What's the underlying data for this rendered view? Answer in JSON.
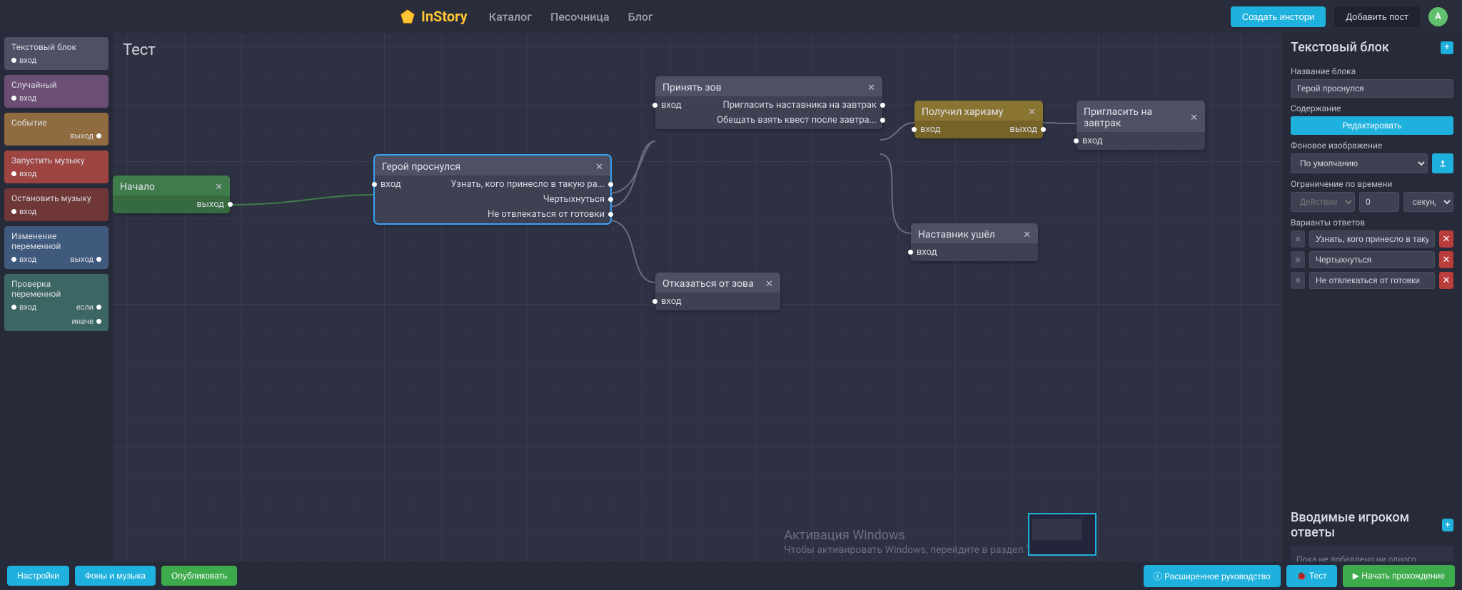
{
  "header": {
    "brand": "InStory",
    "links": [
      "Каталог",
      "Песочница",
      "Блог"
    ],
    "create_story": "Создать инстори",
    "add_post": "Добавить пост",
    "avatar_initial": "A"
  },
  "palette": [
    {
      "cls": "pb-gray",
      "title": "Текстовый блок",
      "in": "вход",
      "out": ""
    },
    {
      "cls": "pb-purple",
      "title": "Случайный",
      "in": "вход",
      "out": ""
    },
    {
      "cls": "pb-brown",
      "title": "Событие",
      "in": "",
      "out": "выход"
    },
    {
      "cls": "pb-red",
      "title": "Запустить музыку",
      "in": "вход",
      "out": ""
    },
    {
      "cls": "pb-darkred",
      "title": "Остановить музыку",
      "in": "вход",
      "out": ""
    },
    {
      "cls": "pb-blue",
      "title": "Изменение переменной",
      "in": "вход",
      "out": "выход"
    },
    {
      "cls": "pb-teal",
      "title": "Проверка переменной",
      "in": "вход",
      "out": "если",
      "out2": "иначе"
    }
  ],
  "canvas": {
    "title": "Тест",
    "nodes": {
      "start": {
        "title": "Начало",
        "out": "выход"
      },
      "hero": {
        "title": "Герой проснулся",
        "in": "вход",
        "rows": [
          "Узнать, кого принесло в такую ра...",
          "Чертыхнуться",
          "Не отвлекаться от готовки"
        ]
      },
      "accept": {
        "title": "Принять зов",
        "in": "вход",
        "rows": [
          "Пригласить наставника на завтрак",
          "Обещать взять квест после завтра..."
        ]
      },
      "refuse": {
        "title": "Отказаться от зова",
        "in": "вход"
      },
      "charisma": {
        "title": "Получил харизму",
        "in": "вход",
        "out": "выход"
      },
      "invite": {
        "title": "Пригласить на завтрак",
        "in": "вход"
      },
      "mentor_left": {
        "title": "Наставник ушёл",
        "in": "вход"
      }
    }
  },
  "rightpanel": {
    "section1_title": "Текстовый блок",
    "name_label": "Название блока",
    "name_value": "Герой проснулся",
    "content_label": "Содержание",
    "edit_btn": "Редактировать",
    "bg_label": "Фоновое изображение",
    "bg_value": "По умолчанию",
    "time_label": "Ограничение по времени",
    "time_action_placeholder": "Действие",
    "time_value": "0",
    "time_unit": "секунд",
    "answers_label": "Варианты ответов",
    "answers": [
      "Узнать, кого принесло в такую рань",
      "Чертыхнуться",
      "Не отвлекаться от готовки"
    ],
    "section2_title": "Вводимые игроком ответы",
    "section2_empty": "Пока не добавлено ни одного варианта ответа или развилки"
  },
  "bottombar": {
    "settings": "Настройки",
    "bg_music": "Фоны и музыка",
    "publish": "Опубликовать",
    "guide": "Расширенное руководство",
    "test": "Тест",
    "play": "Начать прохождение"
  },
  "watermark": {
    "line1": "Активация Windows",
    "line2": "Чтобы активировать Windows, перейдите в раздел \"Параметры\"."
  }
}
